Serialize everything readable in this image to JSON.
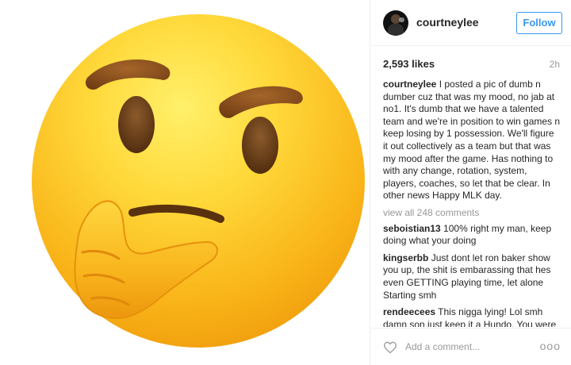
{
  "post": {
    "username": "courtneylee",
    "follow_label": "Follow",
    "likes": "2,593 likes",
    "time": "2h",
    "caption_user": "courtneylee",
    "caption_text": "I posted a pic of dumb n dumber cuz that was my mood, no jab at no1. It's dumb that we have a talented team and we're in position to win games n keep losing by 1 possession. We'll figure it out collectively as a team but that was my mood after the game. Has nothing to with any change, rotation, system, players, coaches, so let that be clear. In other news Happy MLK day.",
    "view_all": "view all 248 comments",
    "comments": [
      {
        "user": "seboistian13",
        "text": "100% right my man, keep doing what your doing"
      },
      {
        "user": "kingserbb",
        "text": "Just dont let ron baker show you up, the shit is embarassing that hes even GETTING playing time, let alone Starting smh"
      },
      {
        "user": "rendeecees",
        "text": "This nigga lying! Lol smh damn son just keep it a Hundo. You were tight baker got the start over you. Stop pump faking and keep it a real. At least we can"
      }
    ],
    "add_comment_placeholder": "Add a comment...",
    "more_label": "ooo"
  },
  "icons": {
    "photo": "thinking-face-emoji",
    "like": "heart-icon",
    "options": "more-options-icon"
  },
  "colors": {
    "follow_blue": "#3897f0",
    "emoji_yellow": "#fcd33c",
    "emoji_orange": "#f5a30c",
    "brow_brown": "#8a4f1c"
  }
}
